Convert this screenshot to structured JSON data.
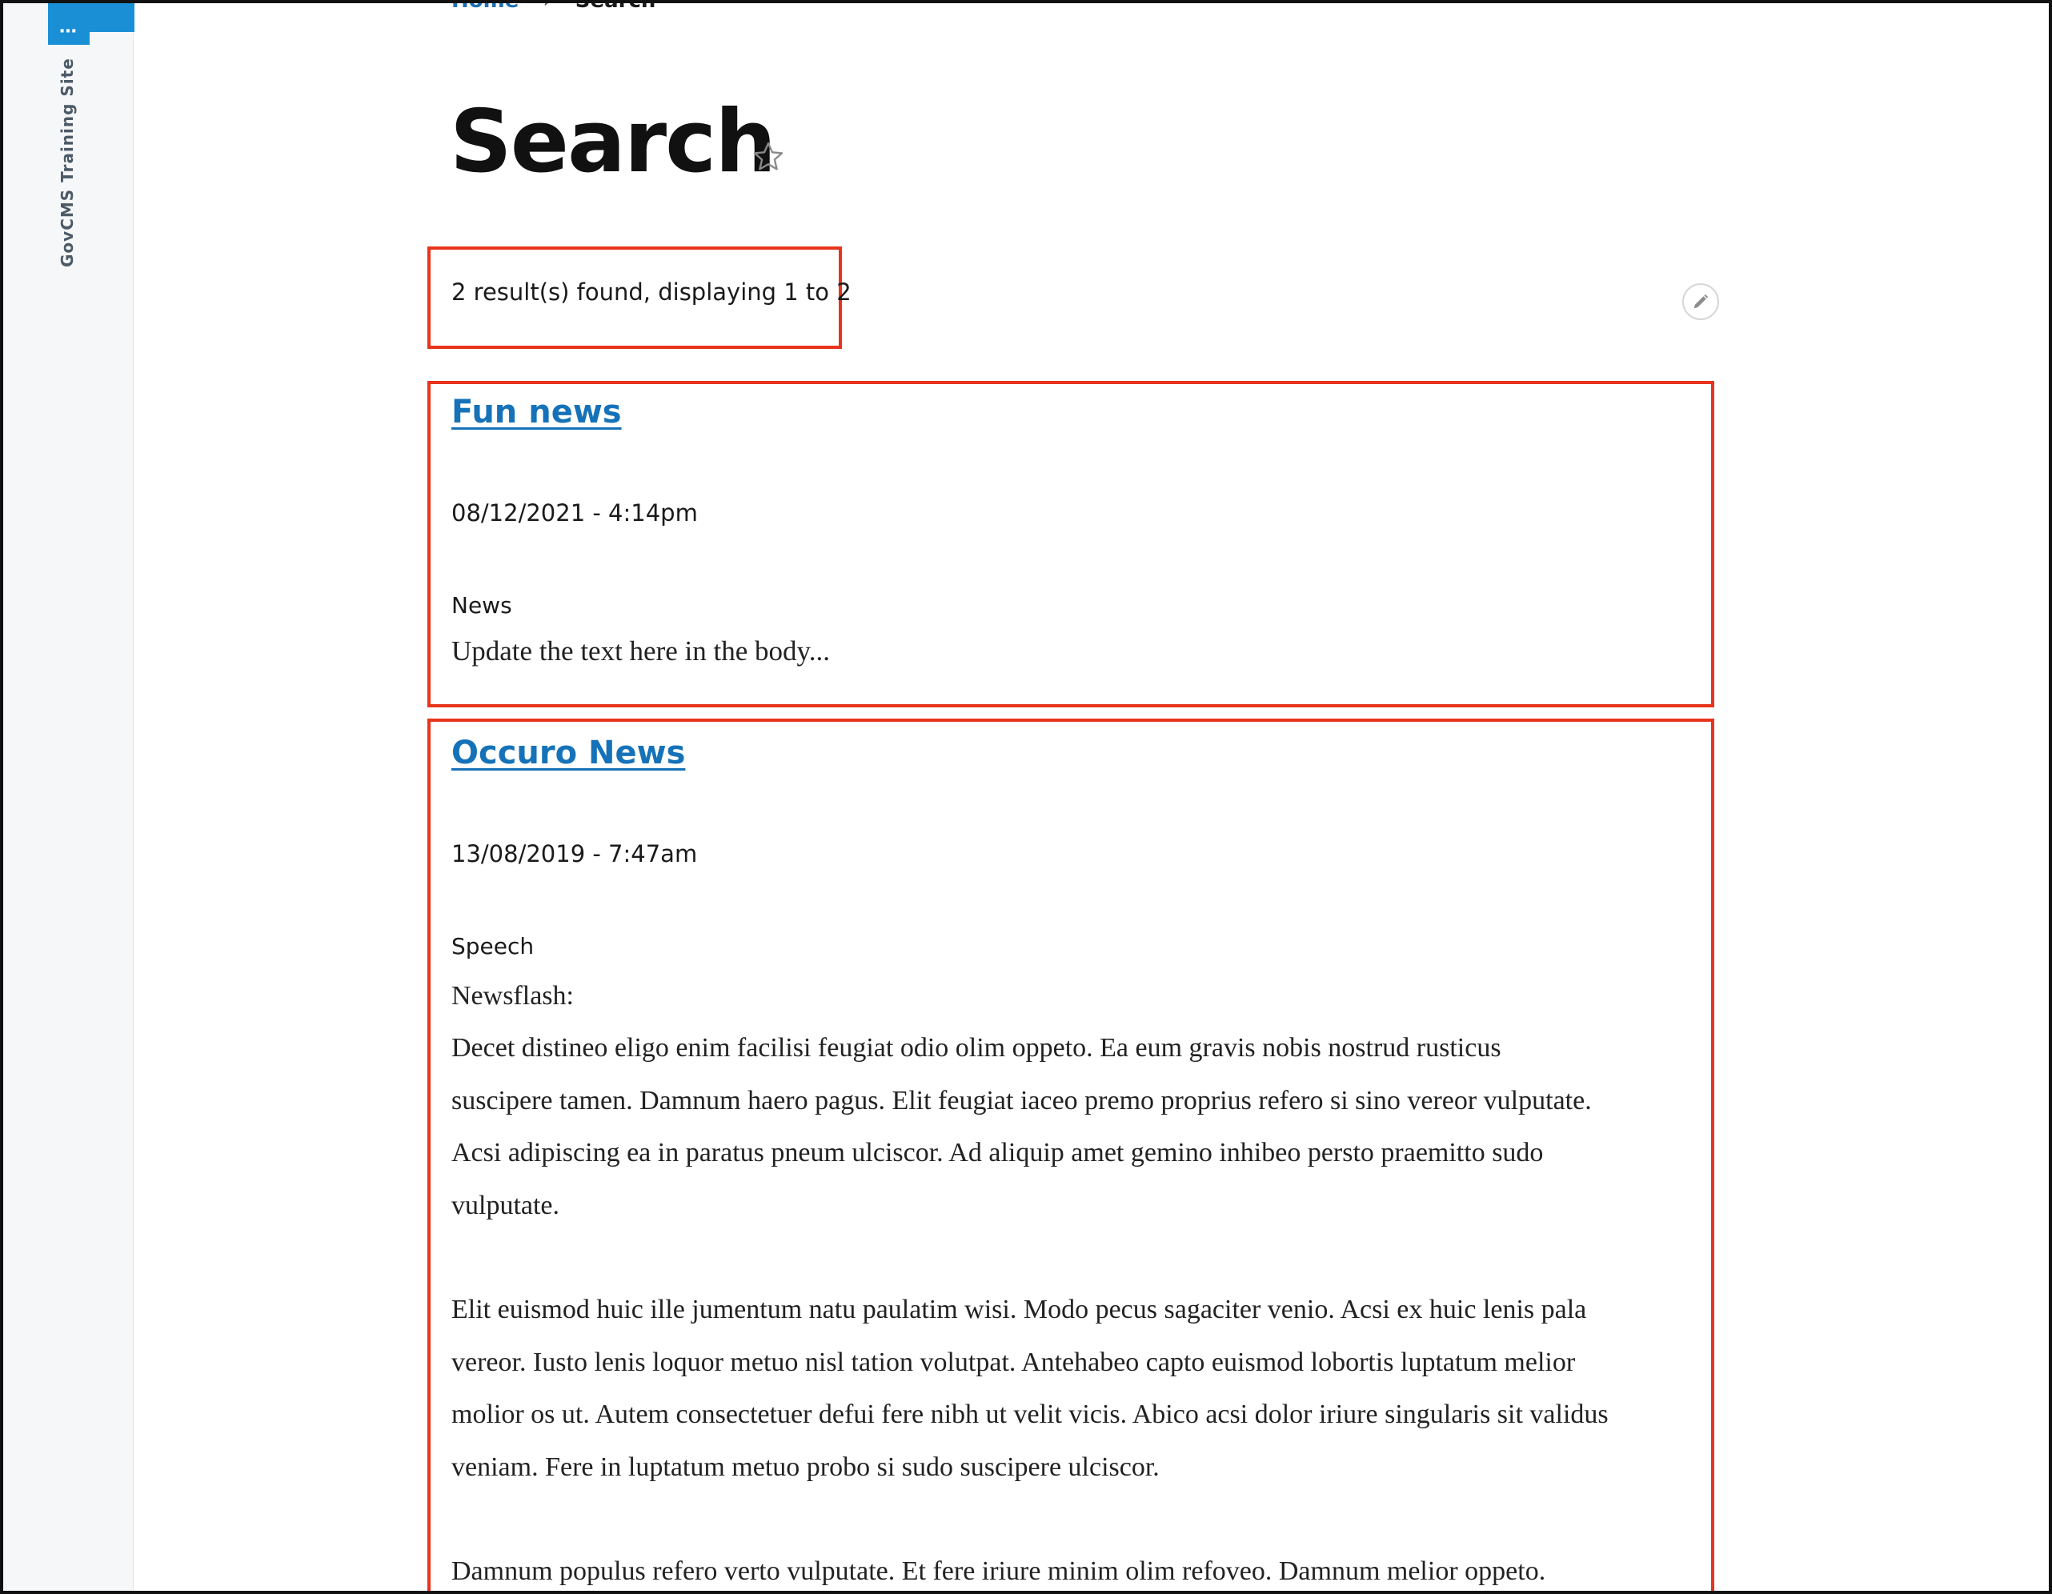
{
  "toolbar": {
    "handle_glyph": "⋯",
    "site_name": "GovCMS Training Site"
  },
  "breadcrumb": {
    "home": "Home",
    "separator": "›",
    "current": "Search"
  },
  "page": {
    "title": "Search",
    "favorite_icon": "star-outline-icon"
  },
  "search": {
    "summary": "2 result(s) found, displaying 1 to 2",
    "edit_icon": "pencil-icon"
  },
  "results": [
    {
      "title": "Fun news",
      "date": "08/12/2021 - 4:14pm",
      "type": "News",
      "excerpt": "Update the text here in the body..."
    },
    {
      "title": "Occuro News",
      "date": "13/08/2019 - 7:47am",
      "type": "Speech",
      "body_lines": [
        "Newsflash:",
        "Decet distineo eligo enim facilisi feugiat odio olim oppeto. Ea eum gravis nobis nostrud rusticus",
        "suscipere tamen. Damnum haero pagus. Elit feugiat iaceo premo proprius refero si sino vereor vulputate.",
        "Acsi adipiscing ea in paratus pneum ulciscor. Ad aliquip amet gemino inhibeo persto praemitto sudo",
        "vulputate.",
        "",
        "Elit euismod huic ille jumentum natu paulatim wisi. Modo pecus sagaciter venio. Acsi ex huic lenis pala",
        "vereor. Iusto lenis loquor metuo nisl tation volutpat. Antehabeo capto euismod lobortis luptatum melior",
        "molior os ut. Autem consectetuer defui fere nibh ut velit vicis. Abico acsi dolor iriure singularis sit validus",
        "veniam. Fere in luptatum metuo probo si sudo suscipere ulciscor.",
        "",
        "Damnum populus refero verto vulputate. Et fere iriure minim olim refoveo. Damnum melior oppeto."
      ]
    }
  ],
  "colors": {
    "link": "#1672b8",
    "highlight_border": "#e8341c",
    "toolbar_accent": "#1a8fd6"
  }
}
